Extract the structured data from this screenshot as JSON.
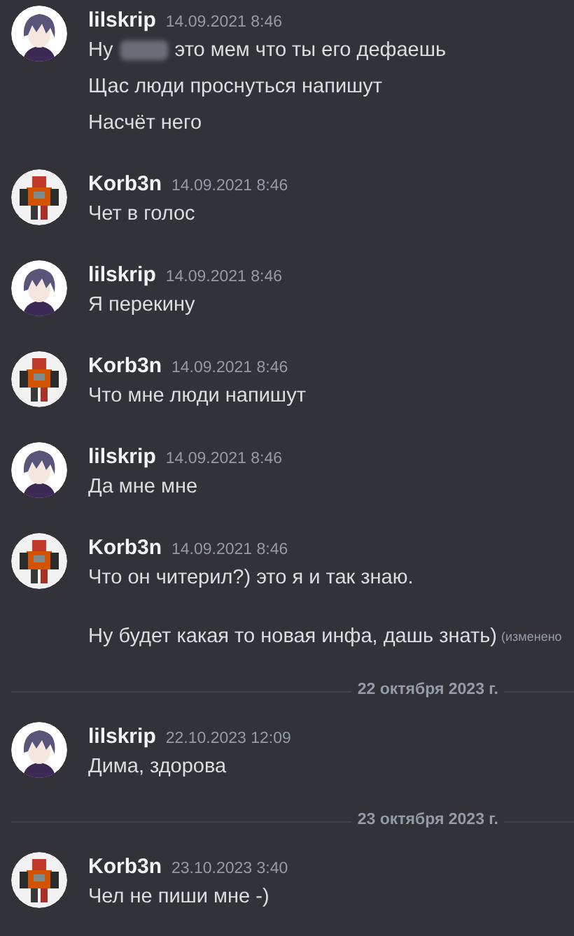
{
  "items": [
    {
      "kind": "message",
      "avatar": {
        "kind": "anime"
      },
      "author": "lilskrip",
      "time": "14.09.2021 8:46",
      "paragraphs": [
        [
          [
            {
              "kind": "text",
              "text": "Ну"
            },
            {
              "kind": "redacted"
            },
            {
              "kind": "text",
              "text": "это мем что ты его дефаешь"
            }
          ],
          [
            {
              "kind": "text",
              "text": "Щас люди проснуться напишут"
            }
          ],
          [
            {
              "kind": "text",
              "text": "Насчёт него"
            }
          ]
        ]
      ]
    },
    {
      "kind": "message",
      "avatar": {
        "kind": "robot"
      },
      "author": "Korb3n",
      "time": "14.09.2021 8:46",
      "paragraphs": [
        [
          [
            {
              "kind": "text",
              "text": "Чет в голос"
            }
          ]
        ]
      ]
    },
    {
      "kind": "message",
      "avatar": {
        "kind": "anime"
      },
      "author": "lilskrip",
      "time": "14.09.2021 8:46",
      "paragraphs": [
        [
          [
            {
              "kind": "text",
              "text": "Я перекину"
            }
          ]
        ]
      ]
    },
    {
      "kind": "message",
      "avatar": {
        "kind": "robot"
      },
      "author": "Korb3n",
      "time": "14.09.2021 8:46",
      "paragraphs": [
        [
          [
            {
              "kind": "text",
              "text": "Что мне люди напишут"
            }
          ]
        ]
      ]
    },
    {
      "kind": "message",
      "avatar": {
        "kind": "anime"
      },
      "author": "lilskrip",
      "time": "14.09.2021 8:46",
      "paragraphs": [
        [
          [
            {
              "kind": "text",
              "text": "Да мне мне"
            }
          ]
        ]
      ]
    },
    {
      "kind": "message",
      "avatar": {
        "kind": "robot"
      },
      "author": "Korb3n",
      "time": "14.09.2021 8:46",
      "paragraphs": [
        [
          [
            {
              "kind": "text",
              "text": "Что он читерил?) это я и так знаю."
            }
          ]
        ],
        [
          [
            {
              "kind": "text",
              "text": "Ну будет какая то новая инфа, дашь знать)"
            }
          ]
        ]
      ],
      "edited": "(изменено"
    },
    {
      "kind": "divider",
      "label": "22 октября 2023 г."
    },
    {
      "kind": "message",
      "avatar": {
        "kind": "anime"
      },
      "author": "lilskrip",
      "time": "22.10.2023 12:09",
      "paragraphs": [
        [
          [
            {
              "kind": "text",
              "text": "Дима, здорова"
            }
          ]
        ]
      ]
    },
    {
      "kind": "divider",
      "label": "23 октября 2023 г."
    },
    {
      "kind": "message",
      "avatar": {
        "kind": "robot"
      },
      "author": "Korb3n",
      "time": "23.10.2023 3:40",
      "paragraphs": [
        [
          [
            {
              "kind": "text",
              "text": "Чел не пиши мне -)"
            }
          ]
        ]
      ]
    }
  ]
}
